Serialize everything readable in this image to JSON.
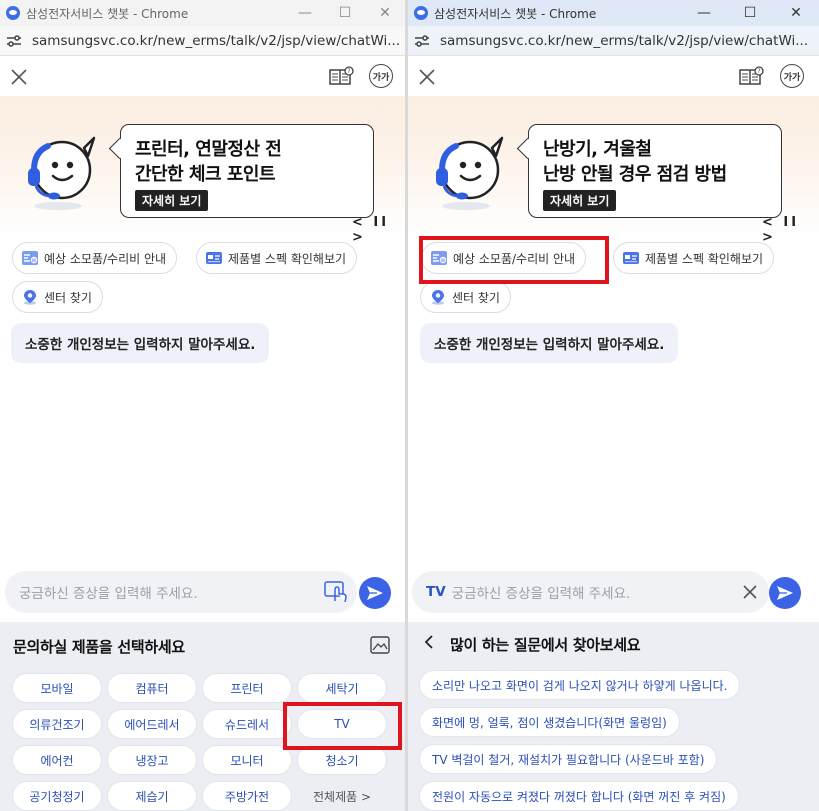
{
  "left": {
    "window": {
      "title": "삼성전자서비스 챗봇 - Chrome",
      "controls": [
        "—",
        "☐",
        "✕"
      ],
      "url": "samsungsvc.co.kr/new_erms/talk/v2/jsp/view/chatWi..."
    },
    "header": {
      "font_size_button": "가가"
    },
    "banner": {
      "line1": "프린터, 연말정산 전",
      "line2": "간단한 체크 포인트",
      "detail_button": "자세히 보기",
      "nav": "< II >"
    },
    "quick_chips": [
      {
        "label": "예상 소모품/수리비 안내",
        "icon": "price-icon"
      },
      {
        "label": "제품별 스펙 확인해보기",
        "icon": "spec-card-icon"
      },
      {
        "label": "센터 찾기",
        "icon": "location-pin-icon"
      }
    ],
    "notice": "소중한 개인정보는 입력하지 말아주세요.",
    "input": {
      "placeholder": "궁금하신 증상을 입력해 주세요."
    },
    "product_selector": {
      "title": "문의하실 제품을 선택하세요",
      "products": [
        [
          "모바일",
          "컴퓨터",
          "프린터",
          "세탁기"
        ],
        [
          "의류건조기",
          "에어드레서",
          "슈드레서",
          "TV"
        ],
        [
          "에어컨",
          "냉장고",
          "모니터",
          "청소기"
        ],
        [
          "공기청정기",
          "제습기",
          "주방가전"
        ]
      ],
      "more": "전체제품 >",
      "highlighted": "TV"
    }
  },
  "right": {
    "window": {
      "title": "삼성전자서비스 챗봇 - Chrome",
      "controls": [
        "—",
        "☐",
        "✕"
      ],
      "url": "samsungsvc.co.kr/new_erms/talk/v2/jsp/view/chatWi..."
    },
    "header": {
      "font_size_button": "가가"
    },
    "banner": {
      "line1": "난방기, 겨울철",
      "line2": "난방 안될 경우 점검 방법",
      "detail_button": "자세히 보기",
      "nav": "< II >"
    },
    "quick_chips": [
      {
        "label": "예상 소모품/수리비 안내",
        "icon": "price-icon"
      },
      {
        "label": "제품별 스펙 확인해보기",
        "icon": "spec-card-icon"
      },
      {
        "label": "센터 찾기",
        "icon": "location-pin-icon"
      }
    ],
    "notice": "소중한 개인정보는 입력하지 말아주세요.",
    "input": {
      "tag": "TV",
      "placeholder": "궁금하신 증상을 입력해 주세요."
    },
    "faq": {
      "title": "많이 하는 질문에서 찾아보세요",
      "items": [
        "소리만 나오고 화면이 검게 나오지 않거나 하얗게 나옵니다.",
        "화면에 멍, 얼룩, 점이 생겼습니다(화면 울렁임)",
        "TV 벽걸이 철거, 재설치가 필요합니다 (사운드바 포함)",
        "전원이 자동으로 켜졌다 꺼졌다 합니다 (화면 꺼진 후 켜짐)"
      ]
    },
    "highlighted": "예상 소모품/수리비 안내"
  },
  "colors": {
    "accent": "#3a63e6",
    "chip_text": "#2a4fb8",
    "highlight_box": "#e0141c",
    "banner_bg": "#fbeee2"
  }
}
